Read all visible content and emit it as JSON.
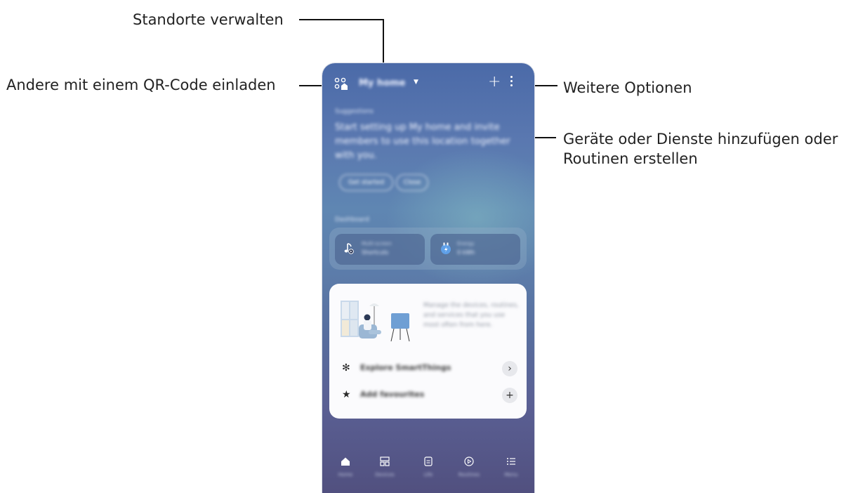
{
  "callouts": {
    "manage_locations": "Standorte verwalten",
    "invite_qr": "Andere mit einem QR-Code einladen",
    "more_options": "Weitere Optionen",
    "add_devices_line1": "Geräte oder Dienste hinzufügen oder",
    "add_devices_line2": "Routinen erstellen"
  },
  "phone": {
    "location_title": "My home",
    "suggestions": {
      "label": "Suggestions",
      "text": "Start setting up My home and invite members to use this location together with you.",
      "get_started": "Get started",
      "close": "Close"
    },
    "dashboard": {
      "label": "Dashboard",
      "tile1_line1": "Multi-screen",
      "tile1_line2": "Shortcuts",
      "tile2_line1": "Energy",
      "tile2_line2": "0 kWh"
    },
    "card": {
      "description": "Manage the devices, routines, and services that you use most often from here.",
      "explore": "Explore SmartThings",
      "favourites": "Add favourites"
    },
    "nav": {
      "home": "Home",
      "devices": "Devices",
      "life": "Life",
      "routines": "Routines",
      "menu": "Menu"
    }
  },
  "colors": {
    "phone_top": "#4b6aa8",
    "phone_bottom": "#51507f",
    "card_bg": "#fbfbfd"
  }
}
